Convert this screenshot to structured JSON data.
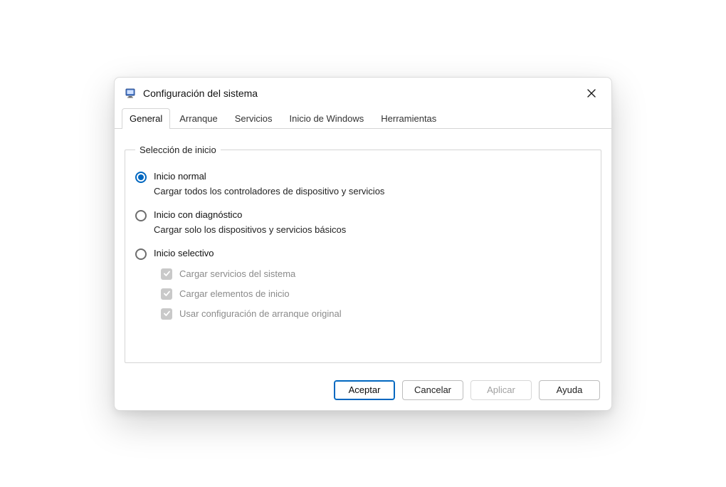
{
  "window": {
    "title": "Configuración del sistema"
  },
  "tabs": [
    {
      "label": "General",
      "active": true
    },
    {
      "label": "Arranque",
      "active": false
    },
    {
      "label": "Servicios",
      "active": false
    },
    {
      "label": "Inicio de Windows",
      "active": false
    },
    {
      "label": "Herramientas",
      "active": false
    }
  ],
  "group": {
    "legend": "Selección de inicio",
    "options": [
      {
        "label": "Inicio normal",
        "description": "Cargar todos los controladores de dispositivo y servicios",
        "selected": true
      },
      {
        "label": "Inicio con diagnóstico",
        "description": "Cargar solo los dispositivos y servicios básicos",
        "selected": false
      },
      {
        "label": "Inicio selectivo",
        "description": "",
        "selected": false
      }
    ],
    "sub_checks": [
      {
        "label": "Cargar servicios del sistema",
        "checked": true,
        "enabled": false
      },
      {
        "label": "Cargar elementos de inicio",
        "checked": true,
        "enabled": false
      },
      {
        "label": "Usar configuración de arranque original",
        "checked": true,
        "enabled": false
      }
    ]
  },
  "buttons": {
    "ok": "Aceptar",
    "cancel": "Cancelar",
    "apply": "Aplicar",
    "help": "Ayuda"
  }
}
